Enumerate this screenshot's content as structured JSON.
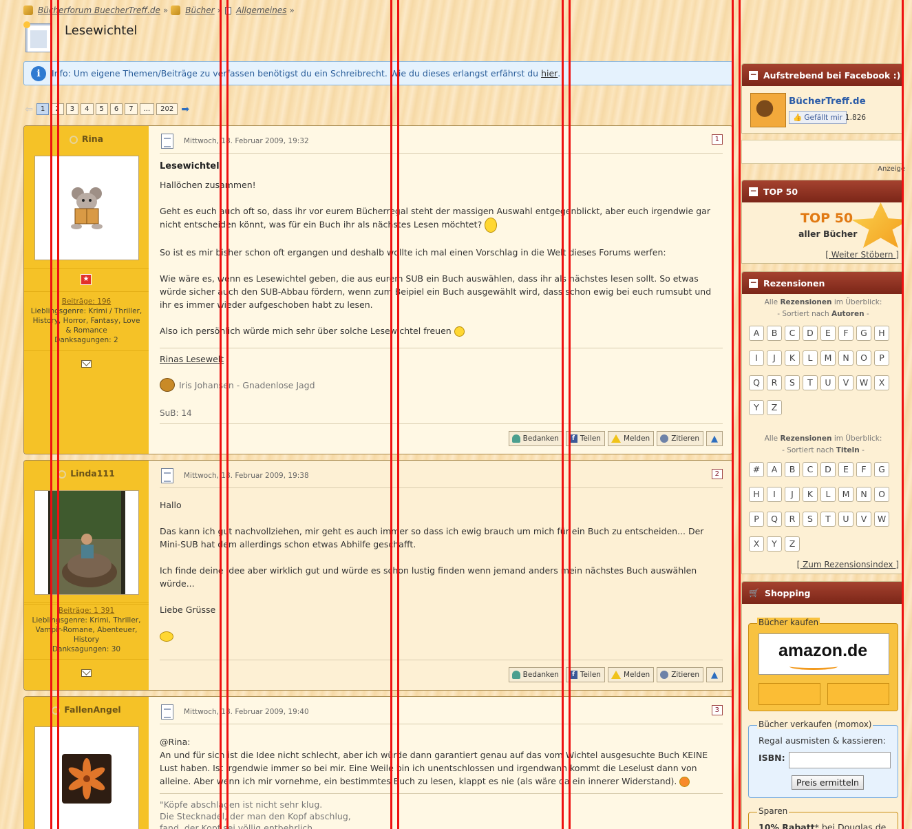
{
  "breadcrumb": {
    "items": [
      "Bücherforum BuecherTreff.de",
      "Bücher",
      "Allgemeines"
    ],
    "sep": "»"
  },
  "thread_title": "Lesewichtel",
  "info": {
    "text": "Info: Um eigene Themen/Beiträge zu verfassen benötigst du ein Schreibrecht. Wie du dieses erlangst erfährst du ",
    "link": "hier",
    "end": "."
  },
  "pagination": {
    "pages": [
      "1",
      "2",
      "3",
      "4",
      "5",
      "6",
      "7",
      "...",
      "202"
    ],
    "active": "1"
  },
  "posts": [
    {
      "user": "Rina",
      "date": "Mittwoch, 18. Februar 2009, 19:32",
      "number": "1",
      "title": "Lesewichtel",
      "stats_link": "Beiträge: 196",
      "stats": "Lieblingsgenre: Krimi / Thriller, History, Horror, Fantasy, Love & Romance",
      "thanks": "Danksagungen: 2",
      "paragraphs": [
        "Hallöchen zusammen!",
        "Geht es euch auch oft so, dass ihr vor eurem Bücherregal steht der massigen Auswahl entgegenblickt, aber euch irgendwie gar nicht entscheiden könnt, was für ein Buch ihr als nächstes Lesen möchtet?",
        "So ist es mir bisher schon oft ergangen und deshalb wollte ich mal einen Vorschlag in die Welt dieses Forums werfen:",
        "Wie wäre es, wenn es Lesewichtel geben, die aus eurem SUB ein Buch auswählen, dass ihr als nächstes lesen sollt. So etwas würde sicher auch den SUB-Abbau fördern, wenn zum Beipiel ein Buch ausgewählt wird, dass schon ewig bei euch rumsubt und ihr es immer wieder aufgeschoben habt zu lesen.",
        "Also ich persönlich würde mich sehr über solche Lesewichtel freuen"
      ],
      "sig_link": "Rinas Lesewelt",
      "sig_book": "Iris Johansen - Gnadenlose Jagd",
      "sig_sub": "SuB: 14"
    },
    {
      "user": "Linda111",
      "date": "Mittwoch, 18. Februar 2009, 19:38",
      "number": "2",
      "stats_link": "Beiträge: 1 391",
      "stats": "Lieblingsgenre: Krimi, Thriller, Vampir-Romane, Abenteuer, History",
      "thanks": "Danksagungen: 30",
      "paragraphs": [
        "Hallo",
        "Das kann ich gut nachvollziehen, mir geht es auch immer so dass ich ewig brauch um mich für ein Buch zu entscheiden... Der Mini-SUB hat dem allerdings schon etwas Abhilfe geschafft.",
        "Ich finde deine Idee aber wirklich gut und würde es schon lustig finden wenn jemand anders mein nächstes Buch auswählen würde...",
        "Liebe Grüsse"
      ]
    },
    {
      "user": "FallenAngel",
      "date": "Mittwoch, 18. Februar 2009, 19:40",
      "number": "3",
      "paragraphs": [
        "@Rina:",
        "An und für sich ist die Idee nicht schlecht, aber ich würde dann garantiert genau auf das vom Wichtel ausgesuchte Buch KEINE Lust haben. Ist irgendwie immer so bei mir. Eine Weile bin ich unentschlossen und irgendwann kommt die Leselust dann von alleine. Aber wenn ich mir vornehme, ein bestimmtes Buch zu lesen, klappt es nie (als wäre da ein innerer Widerstand)."
      ],
      "quote": [
        "\"Köpfe abschlagen ist nicht sehr klug.",
        "Die Stecknadel, der man den Kopf abschlug,",
        "fand, der Kopf sei völlig entbehrlich."
      ]
    }
  ],
  "actions": {
    "thanks": "Bedanken",
    "share": "Teilen",
    "report": "Melden",
    "quote": "Zitieren"
  },
  "sidebar": {
    "facebook": {
      "title": "Aufstrebend bei Facebook :)",
      "name": "BücherTreff.de",
      "like": "Gefällt mir",
      "count": "1.826"
    },
    "anzeige": "Anzeige",
    "top50": {
      "title": "TOP 50",
      "big": "TOP 50",
      "small": "aller Bücher",
      "more": "[ Weiter Stöbern ]"
    },
    "reviews": {
      "title": "Rezensionen",
      "all_prefix": "Alle",
      "all_bold": "Rezensionen",
      "all_suffix": "im Überblick:",
      "by_author_prefix": "- Sortiert nach",
      "by_author_bold": "Autoren",
      "by_title_prefix": "- Sortiert nach",
      "by_title_bold": "Titeln",
      "dash": "-",
      "authors": [
        "A",
        "B",
        "C",
        "D",
        "E",
        "F",
        "G",
        "H",
        "I",
        "J",
        "K",
        "L",
        "M",
        "N",
        "O",
        "P",
        "Q",
        "R",
        "S",
        "T",
        "U",
        "V",
        "W",
        "X",
        "Y",
        "Z"
      ],
      "titles": [
        "#",
        "A",
        "B",
        "C",
        "D",
        "E",
        "F",
        "G",
        "H",
        "I",
        "J",
        "K",
        "L",
        "M",
        "N",
        "O",
        "P",
        "Q",
        "R",
        "S",
        "T",
        "U",
        "V",
        "W",
        "X",
        "Y",
        "Z"
      ],
      "more": "[ Zum Rezensionsindex ]"
    },
    "shopping": {
      "title": "Shopping",
      "buy_legend": "Bücher kaufen",
      "amazon": "amazon.de",
      "sell_legend": "Bücher verkaufen (momox)",
      "sell_text": "Regal ausmisten & kassieren:",
      "isbn": "ISBN:",
      "isbn_value": "",
      "price_button": "Preis ermitteln",
      "save_legend": "Sparen",
      "save_bold": "10% Rabatt",
      "save_text": "* bei Douglas de"
    }
  }
}
